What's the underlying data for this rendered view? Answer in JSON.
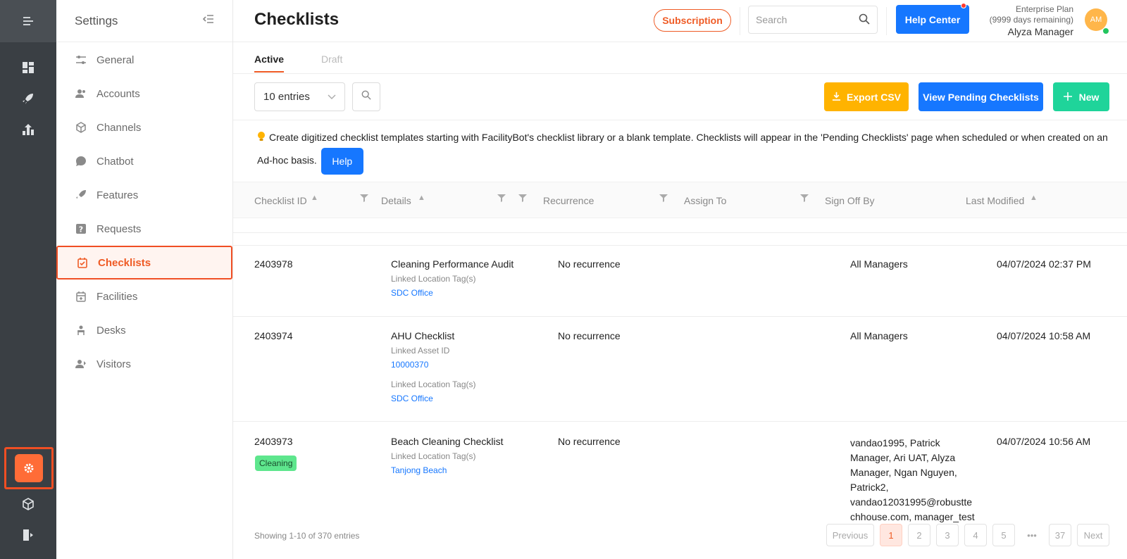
{
  "sidebar": {
    "title": "Settings",
    "items": [
      {
        "label": "General",
        "icon": "sliders-icon"
      },
      {
        "label": "Accounts",
        "icon": "users-icon"
      },
      {
        "label": "Channels",
        "icon": "cube-icon"
      },
      {
        "label": "Chatbot",
        "icon": "chat-icon"
      },
      {
        "label": "Features",
        "icon": "rocket-icon"
      },
      {
        "label": "Requests",
        "icon": "question-icon"
      },
      {
        "label": "Checklists",
        "icon": "checklist-icon"
      },
      {
        "label": "Facilities",
        "icon": "calendar-icon"
      },
      {
        "label": "Desks",
        "icon": "desk-icon"
      },
      {
        "label": "Visitors",
        "icon": "visitor-icon"
      }
    ]
  },
  "header": {
    "title": "Checklists",
    "subscription_label": "Subscription",
    "search_placeholder": "Search",
    "help_center_label": "Help Center",
    "plan_name": "Enterprise Plan",
    "plan_remaining": "(9999 days remaining)",
    "user_name": "Alyza Manager",
    "avatar_initials": "AM"
  },
  "tabs": {
    "active": "Active",
    "draft": "Draft"
  },
  "toolbar": {
    "entries_value": "10 entries",
    "export_label": "Export CSV",
    "pending_label": "View Pending Checklists",
    "new_label": "New"
  },
  "info": {
    "text": "Create digitized checklist templates starting with FacilityBot's checklist library or a blank template. Checklists will appear in the 'Pending Checklists' page when scheduled or when created on an Ad-hoc basis.",
    "help_label": "Help"
  },
  "table": {
    "columns": [
      "Checklist ID",
      "Details",
      "Recurrence",
      "Assign To",
      "Sign Off By",
      "Last Modified"
    ],
    "rows": [
      {
        "id": "2403978",
        "name": "Cleaning Performance Audit",
        "meta1_label": "Linked Location Tag(s)",
        "meta1_value": "SDC Office",
        "recurrence": "No recurrence",
        "sign_off": "All Managers",
        "modified": "04/07/2024 02:37 PM"
      },
      {
        "id": "2403974",
        "name": "AHU Checklist",
        "meta1_label": "Linked Asset ID",
        "meta1_value": "10000370",
        "meta2_label": "Linked Location Tag(s)",
        "meta2_value": "SDC Office",
        "recurrence": "No recurrence",
        "sign_off": "All Managers",
        "modified": "04/07/2024 10:58 AM"
      },
      {
        "id": "2403973",
        "tag": "Cleaning",
        "name": "Beach Cleaning Checklist",
        "meta1_label": "Linked Location Tag(s)",
        "meta1_value": "Tanjong Beach",
        "recurrence": "No recurrence",
        "sign_off_lines": [
          "vandao1995, Patrick",
          "Manager, Ari UAT, Alyza",
          "Manager, Ngan Nguyen,",
          "Patrick2,",
          "vandao12031995@robustte",
          "chhouse.com, manager_test"
        ],
        "modified": "04/07/2024 10:56 AM"
      }
    ]
  },
  "pagination": {
    "showing": "Showing 1-10 of 370 entries",
    "previous": "Previous",
    "pages": [
      "1",
      "2",
      "3",
      "4",
      "5"
    ],
    "ellipsis": "•••",
    "last": "37",
    "next": "Next"
  },
  "colors": {
    "brand": "#ef5b25",
    "primary": "#1677ff",
    "warning": "#ffb300",
    "success": "#1fd49a",
    "rail": "#3a3f44"
  }
}
